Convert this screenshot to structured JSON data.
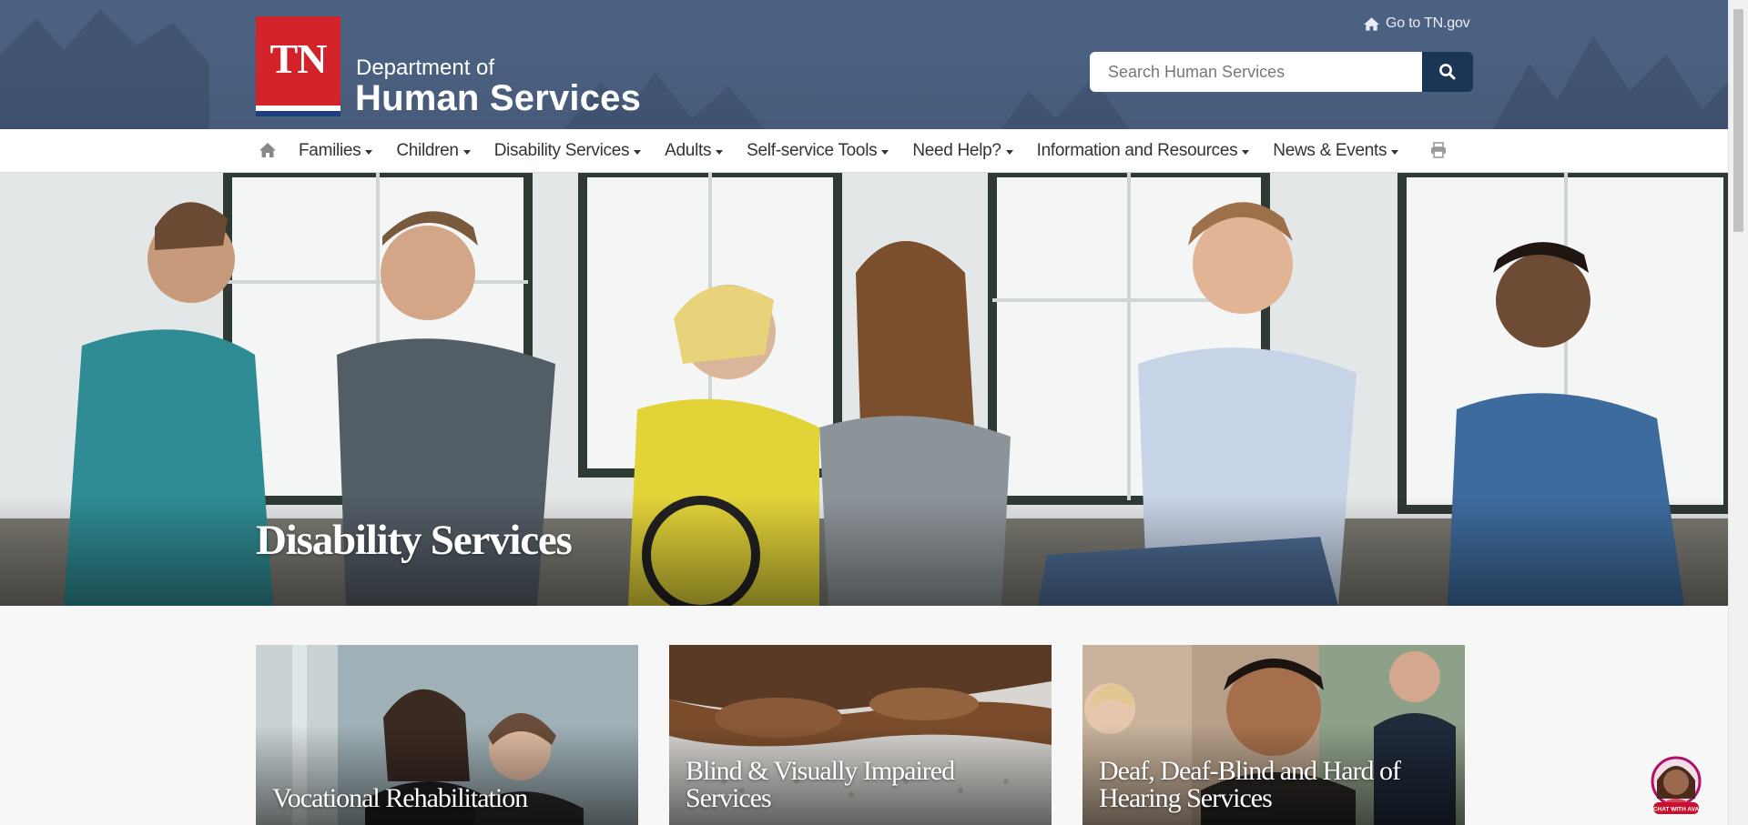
{
  "header": {
    "logo_text": "TN",
    "dept_line1": "Department of",
    "dept_line2": "Human Services",
    "go_tn": "Go to TN.gov",
    "search_placeholder": "Search Human Services"
  },
  "nav": {
    "items": [
      {
        "label": "Families"
      },
      {
        "label": "Children"
      },
      {
        "label": "Disability Services"
      },
      {
        "label": "Adults"
      },
      {
        "label": "Self-service Tools"
      },
      {
        "label": "Need Help?"
      },
      {
        "label": "Information and Resources"
      },
      {
        "label": "News & Events"
      }
    ]
  },
  "hero": {
    "title": "Disability Services"
  },
  "cards": [
    {
      "title": "Vocational Rehabilitation"
    },
    {
      "title": "Blind & Visually Impaired Services"
    },
    {
      "title": "Deaf, Deaf-Blind and Hard of Hearing Services"
    }
  ],
  "chat": {
    "badge_text": "CHAT WITH AVA"
  },
  "colors": {
    "header_bg": "#4a5f7f",
    "search_button": "#1c3557",
    "logo_red": "#d2232a"
  },
  "icons": {
    "home": "home-icon",
    "search": "search-icon",
    "print": "print-icon"
  }
}
